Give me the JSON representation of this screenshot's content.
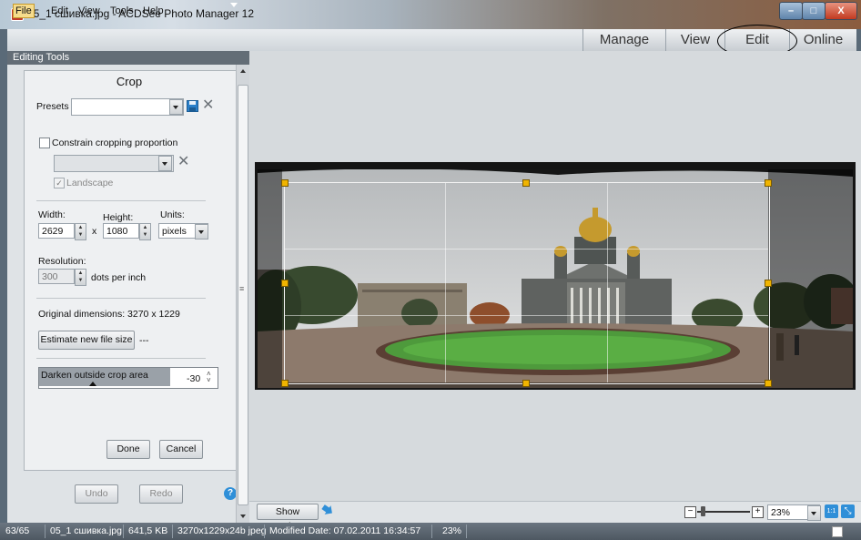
{
  "window": {
    "title": "05_1 сшивка.jpg - ACDSee Photo Manager 12",
    "minimize": "–",
    "maximize": "□",
    "close": "X"
  },
  "menu": {
    "file": "File",
    "edit": "Edit",
    "view": "View",
    "tools": "Tools",
    "help": "Help"
  },
  "modes": {
    "manage": "Manage",
    "view": "View",
    "edit": "Edit",
    "online": "Online"
  },
  "panel": {
    "header": "Editing Tools",
    "title": "Crop",
    "presets_label": "Presets",
    "presets_value": "",
    "constrain_label": "Constrain cropping proportion",
    "constrain_checked": false,
    "ratio_value": "",
    "landscape_label": "Landscape",
    "landscape_checked": true,
    "width_label": "Width:",
    "width_value": "2629",
    "times": "x",
    "height_label": "Height:",
    "height_value": "1080",
    "units_label": "Units:",
    "units_value": "pixels",
    "resolution_label": "Resolution:",
    "resolution_value": "300",
    "dpi_label": "dots per inch",
    "original_dims": "Original dimensions: 3270 x 1229",
    "estimate_button": "Estimate new file size",
    "estimate_result": "---",
    "darken_label": "Darken outside crop area",
    "darken_value": "-30",
    "done": "Done",
    "cancel": "Cancel",
    "undo": "Undo",
    "redo": "Redo",
    "help_glyph": "?"
  },
  "toolbar": {
    "show_previous": "Show Previous",
    "zoom_value": "23%",
    "zoom_minus": "−",
    "zoom_plus": "+",
    "actual_size": "1:1"
  },
  "status": {
    "index": "63/65",
    "filename": "05_1 сшивка.jpg",
    "filesize": "641,5 KB",
    "dims": "3270x1229x24b jpeg",
    "modified": "Modified Date: 07.02.2011 16:34:57",
    "zoom": "23%"
  },
  "colors": {
    "crop_handle": "#f0b400",
    "accent": "#2f8fd8",
    "panel_header": "#636d76"
  }
}
